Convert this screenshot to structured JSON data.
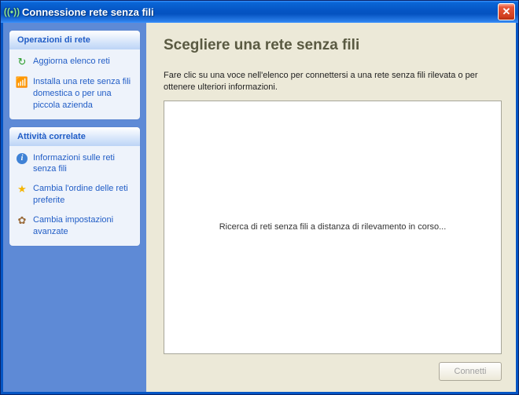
{
  "window": {
    "title": "Connessione rete senza fili"
  },
  "sidebar": {
    "section1": {
      "title": "Operazioni di rete",
      "items": [
        {
          "label": "Aggiorna elenco reti"
        },
        {
          "label": "Installa una rete senza fili domestica o per una piccola azienda"
        }
      ]
    },
    "section2": {
      "title": "Attività correlate",
      "items": [
        {
          "label": "Informazioni sulle reti senza fili"
        },
        {
          "label": "Cambia l'ordine delle reti preferite"
        },
        {
          "label": "Cambia impostazioni avanzate"
        }
      ]
    }
  },
  "main": {
    "heading": "Scegliere una rete senza fili",
    "description": "Fare clic su una voce nell'elenco per connettersi a una rete senza fili rilevata o per ottenere ulteriori informazioni.",
    "status_text": "Ricerca di reti senza fili a distanza di rilevamento in corso..."
  },
  "buttons": {
    "connect": "Connetti"
  }
}
